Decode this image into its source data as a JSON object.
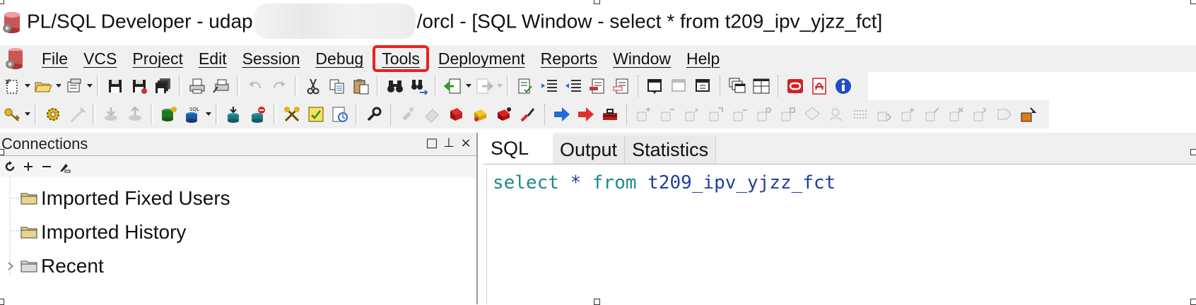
{
  "window": {
    "title_prefix": "PL/SQL Developer - udap",
    "title_suffix": "/orcl - [SQL Window - select * from t209_ipv_yjzz_fct]"
  },
  "menu": {
    "items": [
      {
        "label": "File",
        "highlight": false
      },
      {
        "label": "VCS",
        "highlight": false
      },
      {
        "label": "Project",
        "highlight": false
      },
      {
        "label": "Edit",
        "highlight": false
      },
      {
        "label": "Session",
        "highlight": false
      },
      {
        "label": "Debug",
        "highlight": false
      },
      {
        "label": "Tools",
        "highlight": true
      },
      {
        "label": "Deployment",
        "highlight": false
      },
      {
        "label": "Reports",
        "highlight": false
      },
      {
        "label": "Window",
        "highlight": false
      },
      {
        "label": "Help",
        "highlight": false
      }
    ],
    "highlight_color": "#e8231b"
  },
  "connections": {
    "title": "Connections",
    "controls": [
      "□",
      "⊥",
      "×"
    ],
    "tree": [
      {
        "label": "Imported Fixed Users",
        "expandable": false
      },
      {
        "label": "Imported History",
        "expandable": false
      },
      {
        "label": "Recent",
        "expandable": true
      }
    ]
  },
  "editor": {
    "tabs": [
      {
        "label": "SQL",
        "active": true
      },
      {
        "label": "Output",
        "active": false
      },
      {
        "label": "Statistics",
        "active": false
      }
    ],
    "code": {
      "kw_select": "select",
      "star": "*",
      "kw_from": "from",
      "table": "t209_ipv_yjzz_fct"
    }
  },
  "colors": {
    "keyword": "#1f8a8a",
    "identifier": "#1f3fa0",
    "chrome": "#f0f0f0"
  }
}
